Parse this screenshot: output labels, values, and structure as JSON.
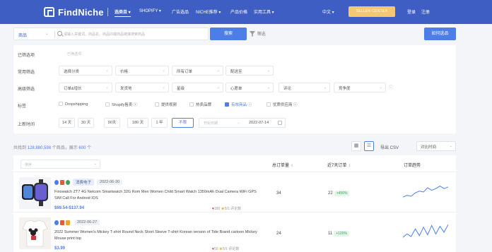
{
  "brand": {
    "logo_text": "FindNiche"
  },
  "nav": {
    "items": [
      {
        "label": "选类目 ▾",
        "active": true
      },
      {
        "label": "SHOPIFY ▾"
      },
      {
        "label": "广告选品"
      },
      {
        "label": "NICHE推荐 ▾"
      },
      {
        "label": "产品价格"
      },
      {
        "label": "实用工具 ▾"
      }
    ],
    "lang": "中文 ▾",
    "seller_center": "SELLER CENTER",
    "login": "登录",
    "register": "注册"
  },
  "search": {
    "scope": "商品",
    "placeholder": "请输入关键词、商品名、商品ID或商品链接搜索商品",
    "button": "搜索",
    "filter_link": "筛选",
    "howto_button": "如何选品"
  },
  "filters": {
    "selected_label": "已筛选项",
    "selected_placeholder": "已筛选项：",
    "common_label": "常用筛选",
    "common": [
      "选择分类",
      "价格",
      "所有订单",
      "配送至"
    ],
    "advanced_label": "高级筛选",
    "advanced": [
      "订单&增长",
      "发货地",
      "星级",
      "心愿单",
      "评论",
      "竞争度"
    ],
    "tags_label": "标签",
    "tags": [
      {
        "label": "Dropshipping",
        "checked": false
      },
      {
        "label": "Shopify售卖 ⓘ",
        "checked": false
      },
      {
        "label": "提供视频",
        "checked": false
      },
      {
        "label": "热卖品牌",
        "checked": false
      },
      {
        "label": "有效商品 ⓘ",
        "checked": true
      },
      {
        "label": "优质供应商 ⓘ",
        "checked": false
      }
    ],
    "time_label": "上新时间",
    "time_buttons": [
      {
        "label": "14 天"
      },
      {
        "label": "30 天"
      },
      {
        "label": "90天"
      },
      {
        "label": "180 天"
      },
      {
        "label": "1 年"
      },
      {
        "label": "不限",
        "active": true
      }
    ],
    "date_start": "开始日期",
    "date_arrow": "→",
    "date_end": "2022-07-14"
  },
  "results": {
    "total_prefix": "共找到 ",
    "total_count": "128,880,598",
    "total_middle": " 个商品，展示 ",
    "shown_count": "600",
    "total_suffix": " 个",
    "export": "导出 CSV",
    "sort_time": "对比时间"
  },
  "table": {
    "sort_placeholder": "排序",
    "headers": {
      "total_orders": "总订单量",
      "orders_7d": "近7天订单",
      "trend": "订单趋势"
    },
    "rows": [
      {
        "category": "消费电子",
        "date": "2022-06-30",
        "title": "Finowatch ZT7 4G Netcom Smartwatch 32G Rom Men Women Child Smart Watch 1350mAh Dual Camera WiFi GPS SIM Call For Android IOS",
        "price": "$69.54-$137.94",
        "wishlist": "180",
        "rating": "5/1 评论数",
        "total_orders": "34",
        "orders_7d": "22",
        "pct_7d": "+450%",
        "trend": [
          0.2,
          0.3,
          0.25,
          0.45,
          0.55,
          0.5,
          0.75,
          0.6,
          0.7,
          0.85,
          0.7,
          0.8
        ]
      },
      {
        "category": "",
        "date": "2022-06-27",
        "title": "2022 Summer Women's Mickey T-shirt Round Neck Short Sleeve T-shirt Korean version of Tide Brand cartoon Mickey Mouse print top",
        "price": "$3.99",
        "wishlist": "50",
        "rating": "5/1 评论数",
        "total_orders": "24",
        "orders_7d": "11",
        "pct_7d": "+120%",
        "trend": [
          0.2,
          0.4,
          0.25,
          0.7,
          0.3,
          0.8,
          0.35,
          0.9,
          0.4,
          0.85,
          0.5,
          0.95
        ]
      }
    ]
  },
  "colors": {
    "primary": "#3e5ec3",
    "accent": "#4d7ee8",
    "seller": "#f4c873",
    "growth": "#3ba55c"
  }
}
